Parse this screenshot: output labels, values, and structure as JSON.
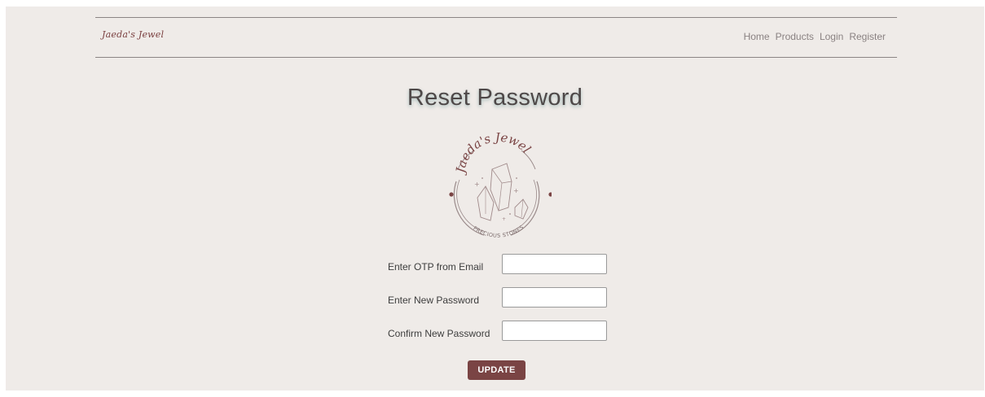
{
  "brand": "Jaeda's Jewel",
  "nav": {
    "links": [
      "Home",
      "Products",
      "Login",
      "Register"
    ]
  },
  "page_title": "Reset Password",
  "logo": {
    "top_text": "Jaeda's Jewel",
    "bottom_text": "PRECIOUS STONES"
  },
  "form": {
    "otp_label": "Enter OTP from Email",
    "otp_value": "",
    "new_password_label": "Enter New Password",
    "new_password_value": "",
    "confirm_password_label": "Confirm New Password",
    "confirm_password_value": "",
    "submit_label": "UPDATE"
  },
  "colors": {
    "background": "#efebe8",
    "accent": "#7a4444",
    "nav_text": "#8a8282",
    "title_text": "#4e4848"
  }
}
